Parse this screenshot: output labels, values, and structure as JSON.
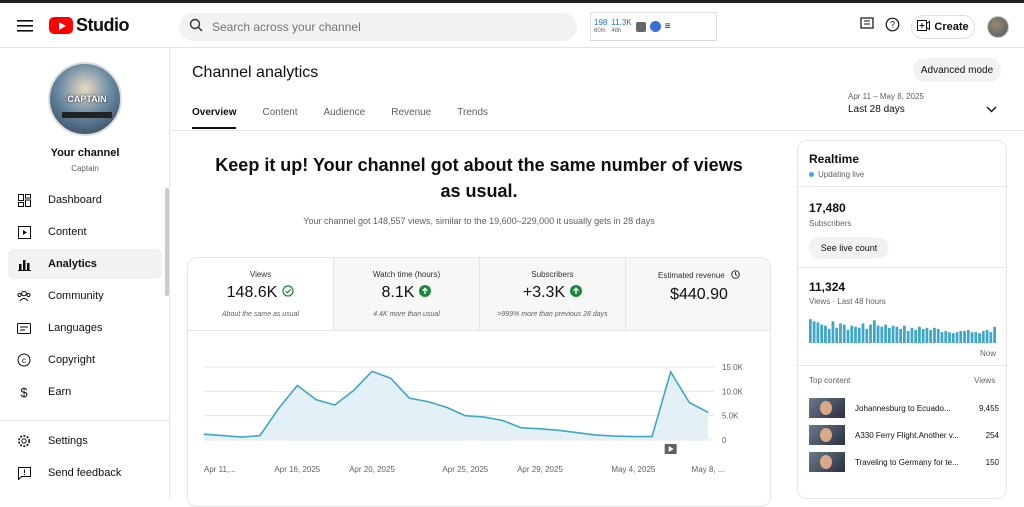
{
  "header": {
    "logo_text": "Studio",
    "search_placeholder": "Search across your channel",
    "ext": {
      "views_60m": "198",
      "label_60m": "60m",
      "views_48h": "11.3K",
      "label_48h": "48h"
    },
    "create_label": "Create"
  },
  "sidebar": {
    "channel_art_text": "CAPTAIN",
    "your_channel": "Your channel",
    "channel_name": "Captain",
    "items": [
      {
        "label": "Dashboard",
        "icon": "dashboard-icon"
      },
      {
        "label": "Content",
        "icon": "content-icon"
      },
      {
        "label": "Analytics",
        "icon": "analytics-icon",
        "active": true
      },
      {
        "label": "Community",
        "icon": "community-icon"
      },
      {
        "label": "Languages",
        "icon": "languages-icon"
      },
      {
        "label": "Copyright",
        "icon": "copyright-icon"
      },
      {
        "label": "Earn",
        "icon": "earn-icon"
      }
    ],
    "settings": "Settings",
    "feedback": "Send feedback"
  },
  "main": {
    "title": "Channel analytics",
    "advanced_mode": "Advanced mode",
    "tabs": [
      "Overview",
      "Content",
      "Audience",
      "Revenue",
      "Trends"
    ],
    "date_range": "Apr 11 – May 8, 2025",
    "date_label": "Last 28 days",
    "headline": "Keep it up! Your channel got about the same number of views as usual.",
    "subline": "Your channel got 148,557 views, similar to the 19,600–229,000 it usually gets in 28 days",
    "metrics": [
      {
        "label": "Views",
        "value": "148.6K",
        "note": "About the same as usual",
        "status": "check"
      },
      {
        "label": "Watch time (hours)",
        "value": "8.1K",
        "note": "4.4K more than usual",
        "status": "up"
      },
      {
        "label": "Subscribers",
        "value": "+3.3K",
        "note": ">999% more than previous 28 days",
        "status": "up"
      },
      {
        "label": "Estimated revenue",
        "value": "$440.90",
        "note": "",
        "status": "clock"
      }
    ]
  },
  "chart_data": {
    "type": "area",
    "x": [
      "Apr 11",
      "Apr 12",
      "Apr 13",
      "Apr 14",
      "Apr 15",
      "Apr 16",
      "Apr 17",
      "Apr 18",
      "Apr 19",
      "Apr 20",
      "Apr 21",
      "Apr 22",
      "Apr 23",
      "Apr 24",
      "Apr 25",
      "Apr 26",
      "Apr 27",
      "Apr 28",
      "Apr 29",
      "Apr 30",
      "May 1",
      "May 2",
      "May 3",
      "May 4",
      "May 5",
      "May 6",
      "May 7",
      "May 8"
    ],
    "values": [
      1200,
      900,
      600,
      900,
      6500,
      11200,
      8300,
      7200,
      10100,
      14100,
      12700,
      8600,
      7900,
      6700,
      5000,
      4700,
      4000,
      2500,
      2300,
      2000,
      1500,
      1000,
      800,
      700,
      700,
      14000,
      7700,
      5700
    ],
    "xtick_labels": [
      "Apr 11,...",
      "Apr 16, 2025",
      "Apr 20, 2025",
      "Apr 25, 2025",
      "Apr 29, 2025",
      "May 4, 2025",
      "May 8, ..."
    ],
    "ytick_labels": [
      "15.0K",
      "10.0K",
      "5.0K",
      "0"
    ],
    "ylim": [
      0,
      15000
    ],
    "color": "#3ea6c8",
    "fill": "#e3f1f7",
    "grid": true
  },
  "realtime": {
    "title": "Realtime",
    "status": "Updating live",
    "subs_value": "17,480",
    "subs_label": "Subscribers",
    "live_button": "See live count",
    "views_value": "11,324",
    "views_label": "Views · Last 48 hours",
    "now_label": "Now",
    "bars": [
      22,
      20,
      19,
      17,
      16,
      13,
      20,
      14,
      18,
      17,
      12,
      16,
      15,
      14,
      18,
      13,
      17,
      21,
      16,
      15,
      17,
      14,
      16,
      15,
      13,
      16,
      11,
      14,
      12,
      15,
      13,
      14,
      12,
      14,
      13,
      10,
      11,
      10,
      9,
      10,
      11,
      11,
      12,
      10,
      10,
      9,
      11,
      12,
      10,
      15
    ],
    "top_content_label": "Top content",
    "top_content_col": "Views",
    "top_content": [
      {
        "title": "Johannesburg to Ecuado...",
        "views": "9,455"
      },
      {
        "title": "A330 Ferry Flight.Another v...",
        "views": "254"
      },
      {
        "title": "Traveling to Germany for te...",
        "views": "150"
      }
    ]
  }
}
